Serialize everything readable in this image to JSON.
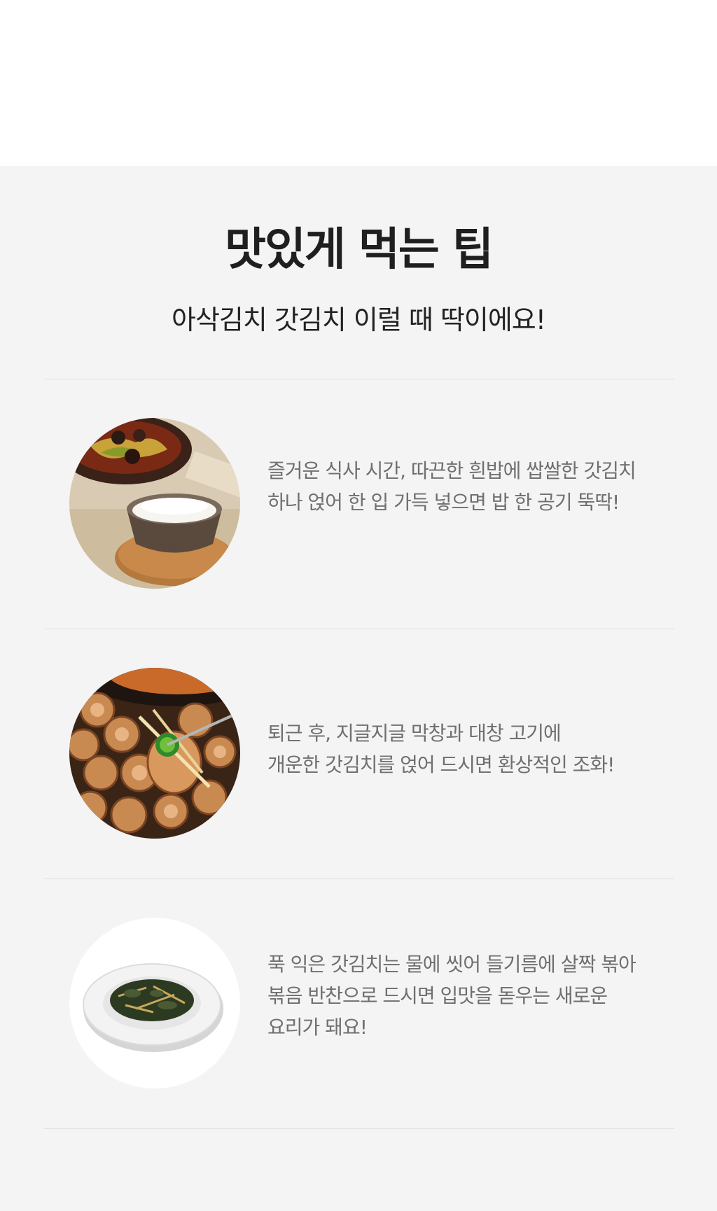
{
  "header": {
    "title": "맛있게 먹는 팁",
    "subtitle": "아삭김치 갓김치 이럴 때 딱이에요!"
  },
  "tips": [
    {
      "photo_icon": "rice-with-kimchi-photo",
      "lines": [
        "즐거운 식사 시간, 따끈한 흰밥에 쌉쌀한 갓김치",
        "하나 얹어 한 입 가득 넣으면 밥 한 공기 뚝딱!"
      ]
    },
    {
      "photo_icon": "grilled-makchang-photo",
      "lines": [
        "퇴근 후, 지글지글 막창과 대창 고기에",
        "개운한 갓김치를 얹어 드시면 환상적인 조화!"
      ]
    },
    {
      "photo_icon": "stir-fried-kimchi-side-dish-photo",
      "lines": [
        "푹 익은 갓김치는 물에 씻어 들기름에 살짝 볶아",
        "볶음 반찬으로 드시면 입맛을 돋우는 새로운",
        "요리가 돼요!"
      ]
    }
  ],
  "colors": {
    "top_background": "#ffffff",
    "section_background": "#f4f4f4",
    "title": "#1f1f1f",
    "body_text": "#6f6f6f",
    "divider": "#dedede"
  }
}
